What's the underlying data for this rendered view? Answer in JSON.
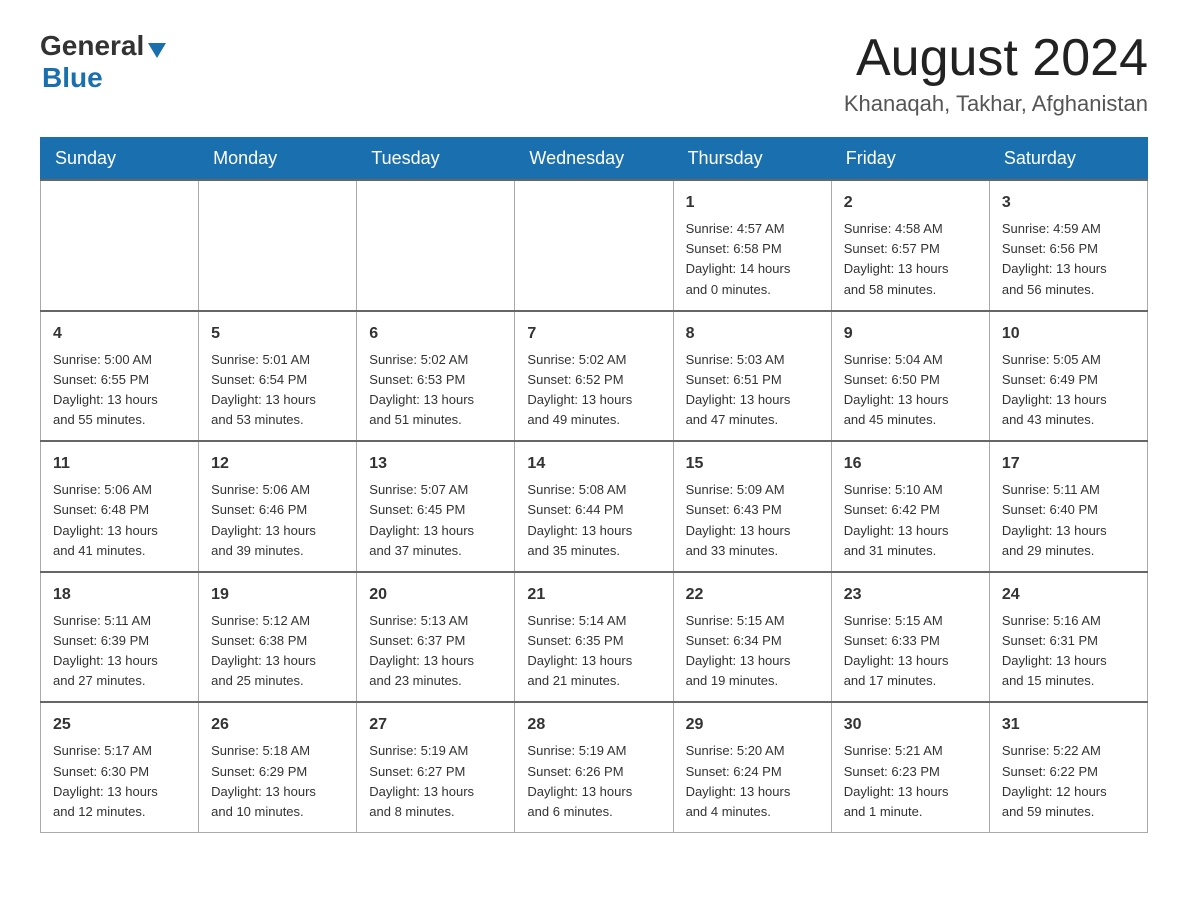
{
  "logo": {
    "general": "General",
    "triangle": "▶",
    "blue": "Blue"
  },
  "header": {
    "month_year": "August 2024",
    "location": "Khanaqah, Takhar, Afghanistan"
  },
  "weekdays": [
    "Sunday",
    "Monday",
    "Tuesday",
    "Wednesday",
    "Thursday",
    "Friday",
    "Saturday"
  ],
  "weeks": [
    [
      {
        "day": "",
        "info": ""
      },
      {
        "day": "",
        "info": ""
      },
      {
        "day": "",
        "info": ""
      },
      {
        "day": "",
        "info": ""
      },
      {
        "day": "1",
        "info": "Sunrise: 4:57 AM\nSunset: 6:58 PM\nDaylight: 14 hours\nand 0 minutes."
      },
      {
        "day": "2",
        "info": "Sunrise: 4:58 AM\nSunset: 6:57 PM\nDaylight: 13 hours\nand 58 minutes."
      },
      {
        "day": "3",
        "info": "Sunrise: 4:59 AM\nSunset: 6:56 PM\nDaylight: 13 hours\nand 56 minutes."
      }
    ],
    [
      {
        "day": "4",
        "info": "Sunrise: 5:00 AM\nSunset: 6:55 PM\nDaylight: 13 hours\nand 55 minutes."
      },
      {
        "day": "5",
        "info": "Sunrise: 5:01 AM\nSunset: 6:54 PM\nDaylight: 13 hours\nand 53 minutes."
      },
      {
        "day": "6",
        "info": "Sunrise: 5:02 AM\nSunset: 6:53 PM\nDaylight: 13 hours\nand 51 minutes."
      },
      {
        "day": "7",
        "info": "Sunrise: 5:02 AM\nSunset: 6:52 PM\nDaylight: 13 hours\nand 49 minutes."
      },
      {
        "day": "8",
        "info": "Sunrise: 5:03 AM\nSunset: 6:51 PM\nDaylight: 13 hours\nand 47 minutes."
      },
      {
        "day": "9",
        "info": "Sunrise: 5:04 AM\nSunset: 6:50 PM\nDaylight: 13 hours\nand 45 minutes."
      },
      {
        "day": "10",
        "info": "Sunrise: 5:05 AM\nSunset: 6:49 PM\nDaylight: 13 hours\nand 43 minutes."
      }
    ],
    [
      {
        "day": "11",
        "info": "Sunrise: 5:06 AM\nSunset: 6:48 PM\nDaylight: 13 hours\nand 41 minutes."
      },
      {
        "day": "12",
        "info": "Sunrise: 5:06 AM\nSunset: 6:46 PM\nDaylight: 13 hours\nand 39 minutes."
      },
      {
        "day": "13",
        "info": "Sunrise: 5:07 AM\nSunset: 6:45 PM\nDaylight: 13 hours\nand 37 minutes."
      },
      {
        "day": "14",
        "info": "Sunrise: 5:08 AM\nSunset: 6:44 PM\nDaylight: 13 hours\nand 35 minutes."
      },
      {
        "day": "15",
        "info": "Sunrise: 5:09 AM\nSunset: 6:43 PM\nDaylight: 13 hours\nand 33 minutes."
      },
      {
        "day": "16",
        "info": "Sunrise: 5:10 AM\nSunset: 6:42 PM\nDaylight: 13 hours\nand 31 minutes."
      },
      {
        "day": "17",
        "info": "Sunrise: 5:11 AM\nSunset: 6:40 PM\nDaylight: 13 hours\nand 29 minutes."
      }
    ],
    [
      {
        "day": "18",
        "info": "Sunrise: 5:11 AM\nSunset: 6:39 PM\nDaylight: 13 hours\nand 27 minutes."
      },
      {
        "day": "19",
        "info": "Sunrise: 5:12 AM\nSunset: 6:38 PM\nDaylight: 13 hours\nand 25 minutes."
      },
      {
        "day": "20",
        "info": "Sunrise: 5:13 AM\nSunset: 6:37 PM\nDaylight: 13 hours\nand 23 minutes."
      },
      {
        "day": "21",
        "info": "Sunrise: 5:14 AM\nSunset: 6:35 PM\nDaylight: 13 hours\nand 21 minutes."
      },
      {
        "day": "22",
        "info": "Sunrise: 5:15 AM\nSunset: 6:34 PM\nDaylight: 13 hours\nand 19 minutes."
      },
      {
        "day": "23",
        "info": "Sunrise: 5:15 AM\nSunset: 6:33 PM\nDaylight: 13 hours\nand 17 minutes."
      },
      {
        "day": "24",
        "info": "Sunrise: 5:16 AM\nSunset: 6:31 PM\nDaylight: 13 hours\nand 15 minutes."
      }
    ],
    [
      {
        "day": "25",
        "info": "Sunrise: 5:17 AM\nSunset: 6:30 PM\nDaylight: 13 hours\nand 12 minutes."
      },
      {
        "day": "26",
        "info": "Sunrise: 5:18 AM\nSunset: 6:29 PM\nDaylight: 13 hours\nand 10 minutes."
      },
      {
        "day": "27",
        "info": "Sunrise: 5:19 AM\nSunset: 6:27 PM\nDaylight: 13 hours\nand 8 minutes."
      },
      {
        "day": "28",
        "info": "Sunrise: 5:19 AM\nSunset: 6:26 PM\nDaylight: 13 hours\nand 6 minutes."
      },
      {
        "day": "29",
        "info": "Sunrise: 5:20 AM\nSunset: 6:24 PM\nDaylight: 13 hours\nand 4 minutes."
      },
      {
        "day": "30",
        "info": "Sunrise: 5:21 AM\nSunset: 6:23 PM\nDaylight: 13 hours\nand 1 minute."
      },
      {
        "day": "31",
        "info": "Sunrise: 5:22 AM\nSunset: 6:22 PM\nDaylight: 12 hours\nand 59 minutes."
      }
    ]
  ]
}
